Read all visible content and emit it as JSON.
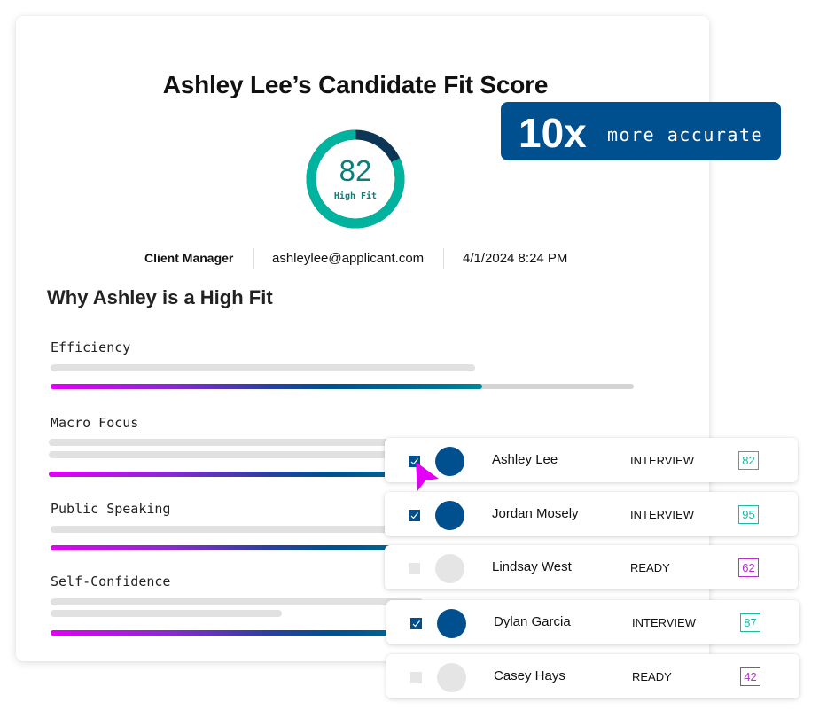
{
  "profile": {
    "title": "Ashley Lee’s Candidate Fit Score",
    "score": "82",
    "score_fraction": 0.82,
    "fit_label": "High Fit",
    "role": "Client Manager",
    "email": "ashleylee@applicant.com",
    "timestamp": "4/1/2024  8:24 PM"
  },
  "badge": {
    "multiplier": "10x",
    "text": "more accurate"
  },
  "why": {
    "title": "Why Ashley is a High Fit",
    "traits": [
      {
        "label": "Efficiency",
        "progress": 0.74
      },
      {
        "label": "Macro Focus",
        "progress": 0.58
      },
      {
        "label": "Public Speaking",
        "progress": 0.85
      },
      {
        "label": "Self-Confidence",
        "progress": 0.66
      }
    ]
  },
  "candidates": [
    {
      "name": "Ashley Lee",
      "status": "INTERVIEW",
      "score": "82",
      "checked": true,
      "score_color": "#1bb9a6"
    },
    {
      "name": "Jordan Mosely",
      "status": "INTERVIEW",
      "score": "95",
      "checked": true,
      "score_color": "#1bb9a6"
    },
    {
      "name": "Lindsay West",
      "status": "READY",
      "score": "62",
      "checked": false,
      "score_color": "#b52fd1"
    },
    {
      "name": "Dylan Garcia",
      "status": "INTERVIEW",
      "score": "87",
      "checked": true,
      "score_color": "#1bb9a6"
    },
    {
      "name": "Casey Hays",
      "status": "READY",
      "score": "42",
      "checked": false,
      "score_color": "#b52fd1"
    }
  ],
  "colors": {
    "brand_blue": "#00508f",
    "teal": "#00b39f",
    "gauge_remaining": "#0c3556",
    "magenta": "#e200f5"
  }
}
